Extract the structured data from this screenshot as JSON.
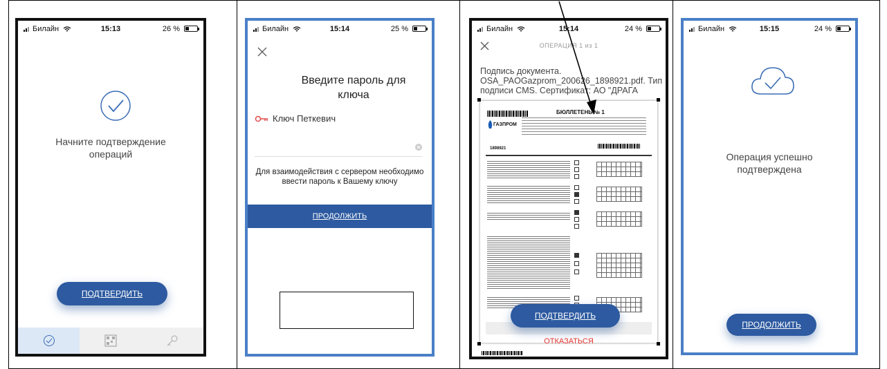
{
  "screens": [
    {
      "status": {
        "carrier": "Билайн",
        "time": "15:13",
        "battery": "26 %"
      },
      "message": "Начните подтверждение операций",
      "confirm_label": "ПОДТВЕРДИТЬ",
      "tabs": [
        "check-icon",
        "qr-icon",
        "key-icon"
      ]
    },
    {
      "status": {
        "carrier": "Билайн",
        "time": "15:14",
        "battery": "25 %"
      },
      "title": "Введите пароль для ключа",
      "key_name": "Ключ Петкевич",
      "hint": "Для взаимодействия с сервером необходимо ввести пароль к Вашему ключу",
      "continue_label": "ПРОДОЛЖИТЬ"
    },
    {
      "status": {
        "carrier": "Билайн",
        "time": "15:14",
        "battery": "24 %"
      },
      "header": "ОПЕРАЦИЯ 1 из 1",
      "sign_text": "Подпись документа. OSA_PAOGazprom_200626_1898921.pdf. Тип подписи CMS. Сертификат: АО \"ДРАГА",
      "doc_title": "БЮЛЛЕТЕНЬ № 1",
      "doc_logo": "ГАЗПРОМ",
      "doc_account": "1898921",
      "confirm_label": "ПОДТВЕРДИТЬ",
      "reject_label": "ОТКАЗАТЬСЯ"
    },
    {
      "status": {
        "carrier": "Билайн",
        "time": "15:15",
        "battery": "24 %"
      },
      "message": "Операция успешно подтверждена",
      "continue_label": "ПРОДОЛЖИТЬ"
    }
  ],
  "colors": {
    "accent": "#2d5aa0",
    "icon": "#3a6db5",
    "frame_blue": "#4a7fc7",
    "reject": "#e0342f",
    "key": "#e04a4a"
  }
}
